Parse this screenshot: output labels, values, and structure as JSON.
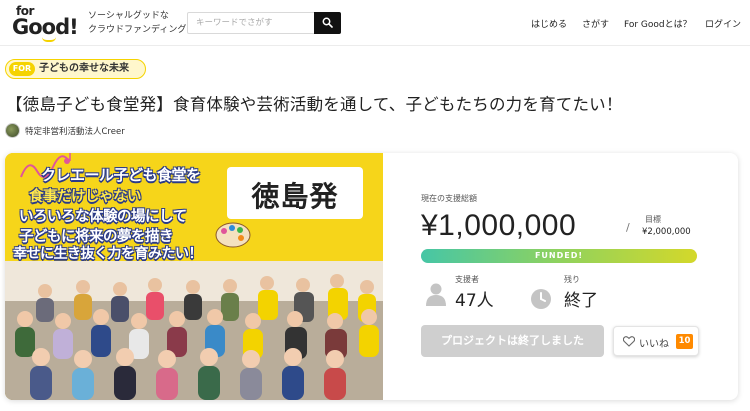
{
  "header": {
    "logo_top": "for",
    "logo_bottom": "Good!",
    "tagline_line1": "ソーシャルグッドな",
    "tagline_line2": "クラウドファンディング",
    "search_placeholder": "キーワードでさがす",
    "nav": [
      "はじめる",
      "さがす",
      "For Goodとは？",
      "ログイン"
    ]
  },
  "category": {
    "tag": "FOR",
    "label": "子どもの幸せな未来"
  },
  "project": {
    "title": "【徳島子ども食堂発】食育体験や芸術活動を通して、子どもたちの力を育てたい！",
    "organization": "特定非営利活動法人Creer"
  },
  "hero": {
    "lines": [
      "クレエール子ども食堂を",
      "食事だけじゃない",
      "いろいろな体験の場にして",
      "子どもに将来の夢を描き",
      "幸せに生き抜く力を育みたい！"
    ],
    "badge": "徳島発"
  },
  "funding": {
    "total_label": "現在の支援総額",
    "total_amount": "¥1,000,000",
    "goal_label": "目標",
    "goal_amount": "¥2,000,000",
    "progress_fraction": 1.0,
    "progress_text": "FUNDED!",
    "supporters_label": "支援者",
    "supporters_value": "47人",
    "remaining_label": "残り",
    "remaining_value": "終了",
    "ended_button": "プロジェクトは終了しました",
    "like_label": "いいね",
    "like_count": "10"
  },
  "colors": {
    "brand_yellow": "#f5d300",
    "like_badge": "#ff8a00",
    "progress_start": "#46c6a6",
    "progress_end": "#d4d82a"
  }
}
